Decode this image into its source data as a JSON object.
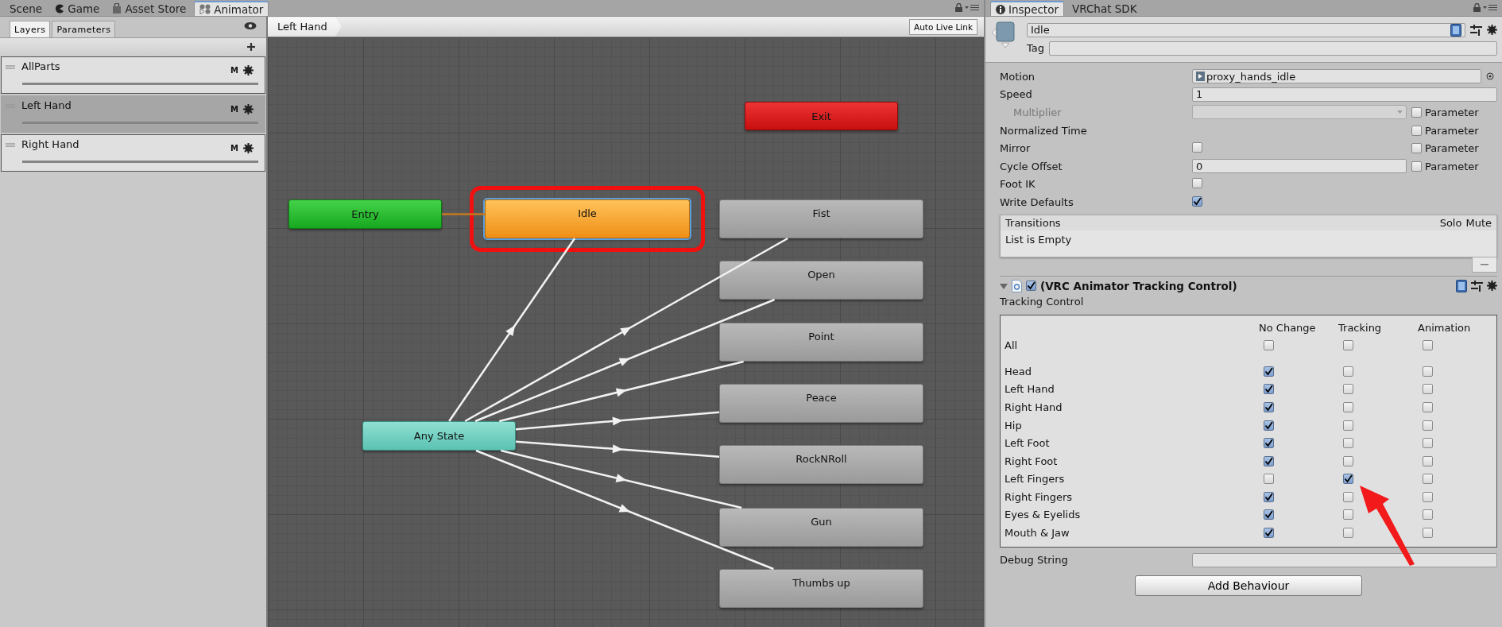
{
  "editor_tabs": [
    {
      "label": "Scene",
      "selected": false
    },
    {
      "label": "Game",
      "selected": false
    },
    {
      "label": "Asset Store",
      "selected": false
    },
    {
      "label": "Animator",
      "selected": true
    }
  ],
  "layers_panel": {
    "tabs": [
      {
        "label": "Layers",
        "selected": true
      },
      {
        "label": "Parameters",
        "selected": false
      }
    ],
    "layers": [
      {
        "name": "AllParts",
        "mask_label": "M",
        "selected": false
      },
      {
        "name": "Left Hand",
        "mask_label": "M",
        "selected": true
      },
      {
        "name": "Right Hand",
        "mask_label": "M",
        "selected": false
      }
    ]
  },
  "graph": {
    "breadcrumb": "Left Hand",
    "live_link_button": "Auto Live Link",
    "states": [
      {
        "name": "Exit",
        "kind": "exit",
        "default": false,
        "selected": false,
        "highlighted": false
      },
      {
        "name": "Entry",
        "kind": "entry",
        "default": false,
        "selected": false,
        "highlighted": false
      },
      {
        "name": "Idle",
        "kind": "state",
        "default": true,
        "selected": true,
        "highlighted": true
      },
      {
        "name": "Fist",
        "kind": "state",
        "default": false,
        "selected": false,
        "highlighted": false
      },
      {
        "name": "Open",
        "kind": "state",
        "default": false,
        "selected": false,
        "highlighted": false
      },
      {
        "name": "Point",
        "kind": "state",
        "default": false,
        "selected": false,
        "highlighted": false
      },
      {
        "name": "Peace",
        "kind": "state",
        "default": false,
        "selected": false,
        "highlighted": false
      },
      {
        "name": "Any State",
        "kind": "any",
        "default": false,
        "selected": false,
        "highlighted": false
      },
      {
        "name": "RockNRoll",
        "kind": "state",
        "default": false,
        "selected": false,
        "highlighted": false
      },
      {
        "name": "Gun",
        "kind": "state",
        "default": false,
        "selected": false,
        "highlighted": false
      },
      {
        "name": "Thumbs up",
        "kind": "state",
        "default": false,
        "selected": false,
        "highlighted": false
      }
    ]
  },
  "inspector": {
    "tabs": [
      {
        "label": "Inspector",
        "selected": true
      },
      {
        "label": "VRChat SDK",
        "selected": false
      }
    ],
    "name": "Idle",
    "tag_label": "Tag",
    "properties": [
      {
        "label": "Motion",
        "kind": "object",
        "value": "proxy_hands_idle"
      },
      {
        "label": "Speed",
        "kind": "text",
        "value": "1"
      },
      {
        "label": "Multiplier",
        "kind": "dropdown",
        "disabled": true,
        "parameter": {
          "label": "Parameter",
          "checked": false
        }
      },
      {
        "label": "Normalized Time",
        "kind": "none",
        "parameter": {
          "label": "Parameter",
          "checked": false
        }
      },
      {
        "label": "Mirror",
        "kind": "checkbox",
        "checked": false,
        "parameter": {
          "label": "Parameter",
          "checked": false
        }
      },
      {
        "label": "Cycle Offset",
        "kind": "text",
        "value": "0",
        "parameter": {
          "label": "Parameter",
          "checked": false
        }
      },
      {
        "label": "Foot IK",
        "kind": "checkbox",
        "checked": false
      },
      {
        "label": "Write Defaults",
        "kind": "checkbox",
        "checked": true
      }
    ],
    "transitions": {
      "title": "Transitions",
      "solo": "Solo",
      "mute": "Mute",
      "empty_text": "List is Empty"
    },
    "behaviour": {
      "title": "(VRC Animator Tracking Control)",
      "expanded": true,
      "enabled": true,
      "section": "Tracking Control",
      "columns": [
        "No Change",
        "Tracking",
        "Animation"
      ],
      "rows": [
        {
          "label": "All",
          "checks": [
            false,
            false,
            false
          ]
        },
        {
          "label": "Head",
          "checks": [
            true,
            false,
            false
          ]
        },
        {
          "label": "Left Hand",
          "checks": [
            true,
            false,
            false
          ]
        },
        {
          "label": "Right Hand",
          "checks": [
            true,
            false,
            false
          ]
        },
        {
          "label": "Hip",
          "checks": [
            true,
            false,
            false
          ]
        },
        {
          "label": "Left Foot",
          "checks": [
            true,
            false,
            false
          ]
        },
        {
          "label": "Right Foot",
          "checks": [
            true,
            false,
            false
          ]
        },
        {
          "label": "Left Fingers",
          "checks": [
            false,
            true,
            false
          ]
        },
        {
          "label": "Right Fingers",
          "checks": [
            true,
            false,
            false
          ]
        },
        {
          "label": "Eyes & Eyelids",
          "checks": [
            true,
            false,
            false
          ]
        },
        {
          "label": "Mouth & Jaw",
          "checks": [
            true,
            false,
            false
          ]
        }
      ]
    },
    "debug_label": "Debug String",
    "add_button": "Add Behaviour"
  }
}
